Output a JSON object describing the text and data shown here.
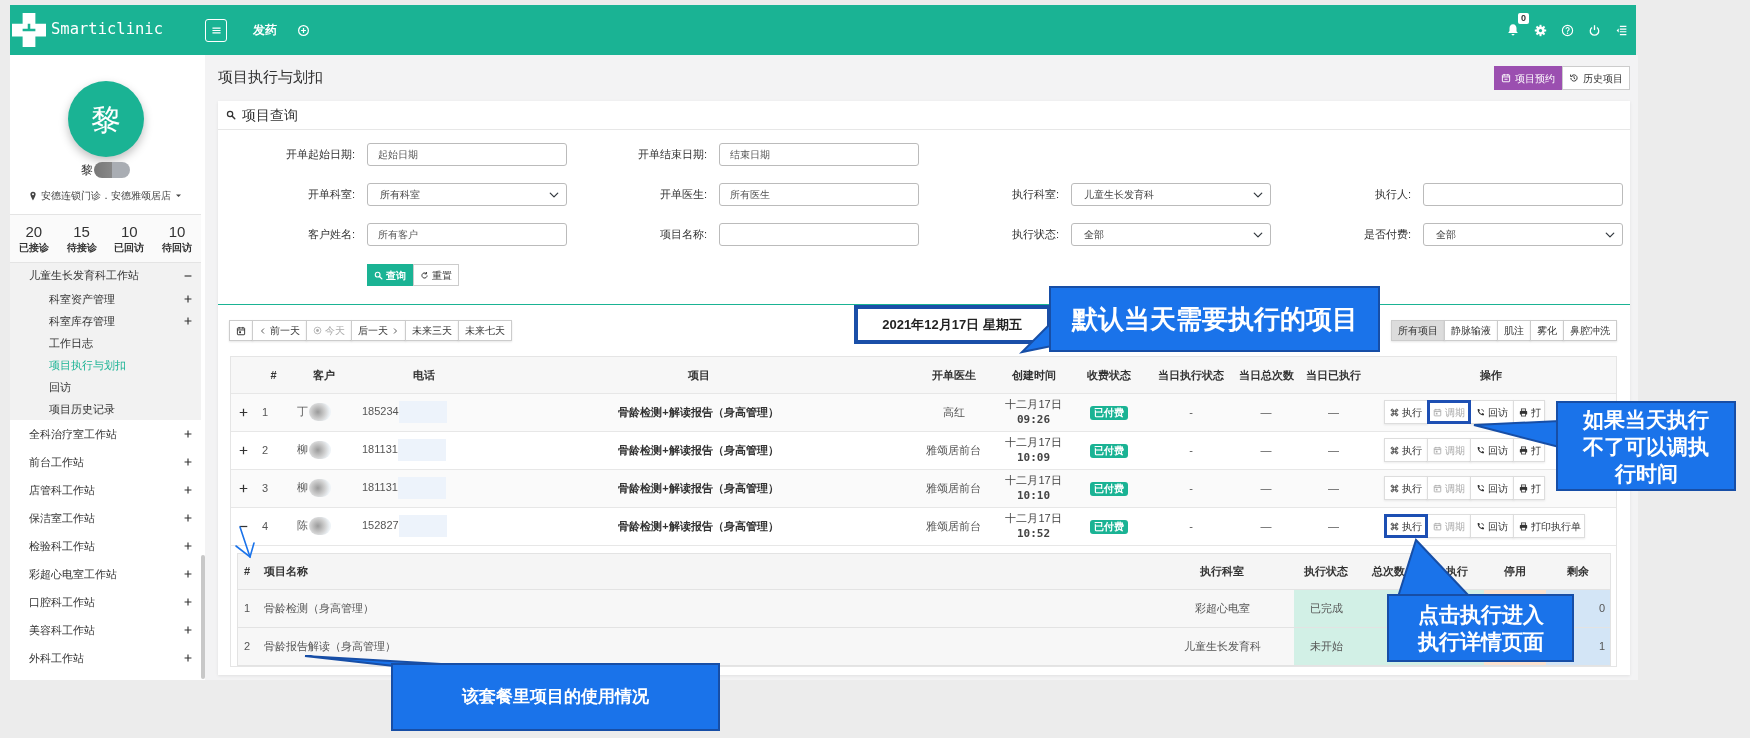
{
  "navbar": {
    "brand": "Smarticlinic",
    "tabs": [
      {
        "label": "发药"
      }
    ],
    "notifications": "0"
  },
  "sidebar": {
    "avatar_initial": "黎",
    "user_name": "黎",
    "redacted": true,
    "location": "安德连锁门诊．安德雅颂居店",
    "stats": [
      {
        "value": "20",
        "label": "已接诊"
      },
      {
        "value": "15",
        "label": "待接诊"
      },
      {
        "value": "10",
        "label": "已回访"
      },
      {
        "value": "10",
        "label": "待回访"
      }
    ],
    "menu": [
      {
        "label": "儿童生长发育科工作站",
        "expanded": true,
        "children": [
          {
            "label": "科室资产管理",
            "expanded": false,
            "selected": false
          },
          {
            "label": "科室库存管理",
            "expanded": false,
            "selected": false
          },
          {
            "label": "工作日志",
            "selected": false
          },
          {
            "label": "项目执行与划扣",
            "selected": true
          },
          {
            "label": "回访",
            "selected": false
          },
          {
            "label": "项目历史记录",
            "selected": false
          }
        ]
      },
      {
        "label": "全科治疗室工作站",
        "expanded": false
      },
      {
        "label": "前台工作站",
        "expanded": false
      },
      {
        "label": "店管科工作站",
        "expanded": false
      },
      {
        "label": "保洁室工作站",
        "expanded": false
      },
      {
        "label": "检验科工作站",
        "expanded": false
      },
      {
        "label": "彩超心电室工作站",
        "expanded": false
      },
      {
        "label": "口腔科工作站",
        "expanded": false
      },
      {
        "label": "美容科工作站",
        "expanded": false
      },
      {
        "label": "外科工作站",
        "expanded": false
      }
    ]
  },
  "page": {
    "title": "项目执行与划扣",
    "actions": [
      {
        "label": "项目预约",
        "kind": "primary"
      },
      {
        "label": "历史项目",
        "kind": "default"
      }
    ]
  },
  "query": {
    "title": "项目查询",
    "rows": [
      [
        {
          "label": "开单起始日期:",
          "kind": "input",
          "placeholder": "起始日期"
        },
        {
          "label": "开单结束日期:",
          "kind": "input",
          "placeholder": "结束日期"
        }
      ],
      [
        {
          "label": "开单科室:",
          "kind": "select",
          "value": "所有科室"
        },
        {
          "label": "开单医生:",
          "kind": "input",
          "placeholder": "所有医生"
        },
        {
          "label": "执行科室:",
          "kind": "select",
          "value": "儿童生长发育科"
        },
        {
          "label": "执行人:",
          "kind": "input"
        }
      ],
      [
        {
          "label": "客户姓名:",
          "kind": "input",
          "placeholder": "所有客户"
        },
        {
          "label": "项目名称:",
          "kind": "input"
        },
        {
          "label": "执行状态:",
          "kind": "select",
          "value": "全部"
        },
        {
          "label": "是否付费:",
          "kind": "select",
          "value": "全部"
        }
      ]
    ],
    "buttons": [
      {
        "label": "查询",
        "kind": "primary"
      },
      {
        "label": "重置",
        "kind": "default"
      }
    ]
  },
  "date_nav": [
    {
      "kind": "calendar",
      "disabled": false
    },
    {
      "kind": "prev",
      "label": "前一天",
      "disabled": false
    },
    {
      "kind": "today",
      "label": "今天",
      "disabled": true
    },
    {
      "kind": "next",
      "label": "后一天",
      "disabled": false
    },
    {
      "kind": "plain",
      "label": "未来三天",
      "disabled": false
    },
    {
      "kind": "plain",
      "label": "未来七天",
      "disabled": false
    }
  ],
  "date_title": "2021年12月17日 星期五",
  "filters": [
    {
      "label": "所有项目",
      "selected": true
    },
    {
      "label": "静脉输液",
      "selected": false
    },
    {
      "label": "肌注",
      "selected": false
    },
    {
      "label": "雾化",
      "selected": false
    },
    {
      "label": "鼻腔冲洗",
      "selected": false
    }
  ],
  "table": {
    "columns": [
      "#",
      "客户",
      "电话",
      "项目",
      "开单医生",
      "创建时间",
      "收费状态",
      "当日执行状态",
      "当日总次数",
      "当日已执行",
      "操作"
    ],
    "rows": [
      {
        "expanded": false,
        "index": "1",
        "customer": "丁",
        "phone": "185234",
        "redacted": true,
        "project": "骨龄检测+解读报告（身高管理）",
        "doctor": "高红",
        "created_date": "十二月17日",
        "created_time": "09:26",
        "payment": "已付费",
        "exec_status": "-",
        "total": "—",
        "done": "—",
        "actions": [
          {
            "label": "执行",
            "kind": "execute",
            "disabled": false,
            "highlighted": false
          },
          {
            "label": "调期",
            "kind": "reschedule",
            "disabled": true,
            "highlighted": true
          },
          {
            "label": "回访",
            "kind": "follow_up",
            "disabled": false,
            "highlighted": false
          },
          {
            "label": "打",
            "kind": "print",
            "disabled": false,
            "highlighted": false
          }
        ]
      },
      {
        "expanded": false,
        "index": "2",
        "customer": "柳",
        "phone": "181131",
        "redacted": true,
        "project": "骨龄检测+解读报告（身高管理）",
        "doctor": "雅颂居前台",
        "created_date": "十二月17日",
        "created_time": "10:09",
        "payment": "已付费",
        "exec_status": "-",
        "total": "—",
        "done": "—",
        "actions": [
          {
            "label": "执行",
            "kind": "execute",
            "disabled": false,
            "highlighted": false
          },
          {
            "label": "调期",
            "kind": "reschedule",
            "disabled": true,
            "highlighted": false
          },
          {
            "label": "回访",
            "kind": "follow_up",
            "disabled": false,
            "highlighted": false
          },
          {
            "label": "打",
            "kind": "print",
            "disabled": false,
            "highlighted": false
          }
        ]
      },
      {
        "expanded": false,
        "index": "3",
        "customer": "柳",
        "phone": "181131",
        "redacted": true,
        "project": "骨龄检测+解读报告（身高管理）",
        "doctor": "雅颂居前台",
        "created_date": "十二月17日",
        "created_time": "10:10",
        "payment": "已付费",
        "exec_status": "-",
        "total": "—",
        "done": "—",
        "actions": [
          {
            "label": "执行",
            "kind": "execute",
            "disabled": false,
            "highlighted": false
          },
          {
            "label": "调期",
            "kind": "reschedule",
            "disabled": true,
            "highlighted": false
          },
          {
            "label": "回访",
            "kind": "follow_up",
            "disabled": false,
            "highlighted": false
          },
          {
            "label": "打",
            "kind": "print",
            "disabled": false,
            "highlighted": false
          }
        ]
      },
      {
        "expanded": true,
        "index": "4",
        "customer": "陈",
        "phone": "152827",
        "redacted": true,
        "project": "骨龄检测+解读报告（身高管理）",
        "doctor": "雅颂居前台",
        "created_date": "十二月17日",
        "created_time": "10:52",
        "payment": "已付费",
        "exec_status": "-",
        "total": "—",
        "done": "—",
        "actions": [
          {
            "label": "执行",
            "kind": "execute",
            "disabled": false,
            "highlighted": true
          },
          {
            "label": "调期",
            "kind": "reschedule",
            "disabled": true,
            "highlighted": false
          },
          {
            "label": "回访",
            "kind": "follow_up",
            "disabled": false,
            "highlighted": false
          },
          {
            "label": "打印执行单",
            "kind": "print",
            "disabled": false,
            "highlighted": false
          }
        ],
        "detail": {
          "columns": [
            "#",
            "项目名称",
            "执行科室",
            "执行状态",
            "总次数",
            "执行",
            "停用",
            "剩余"
          ],
          "rows": [
            {
              "index": "1",
              "name": "骨龄检测（身高管理）",
              "department": "彩超心电室",
              "status": "已完成",
              "remaining": "0"
            },
            {
              "index": "2",
              "name": "骨龄报告解读（身高管理）",
              "department": "儿童生长发育科",
              "status": "未开始",
              "remaining": "1"
            }
          ]
        }
      }
    ]
  },
  "callouts": [
    {
      "lines": [
        "默认当天需要执行的项目"
      ]
    },
    {
      "lines": [
        "如果当天执行",
        "不了可以调执",
        "行时间"
      ]
    },
    {
      "lines": [
        "点击执行进入",
        "执行详情页面"
      ]
    },
    {
      "lines": [
        "该套餐里项目的使用情况"
      ]
    }
  ]
}
